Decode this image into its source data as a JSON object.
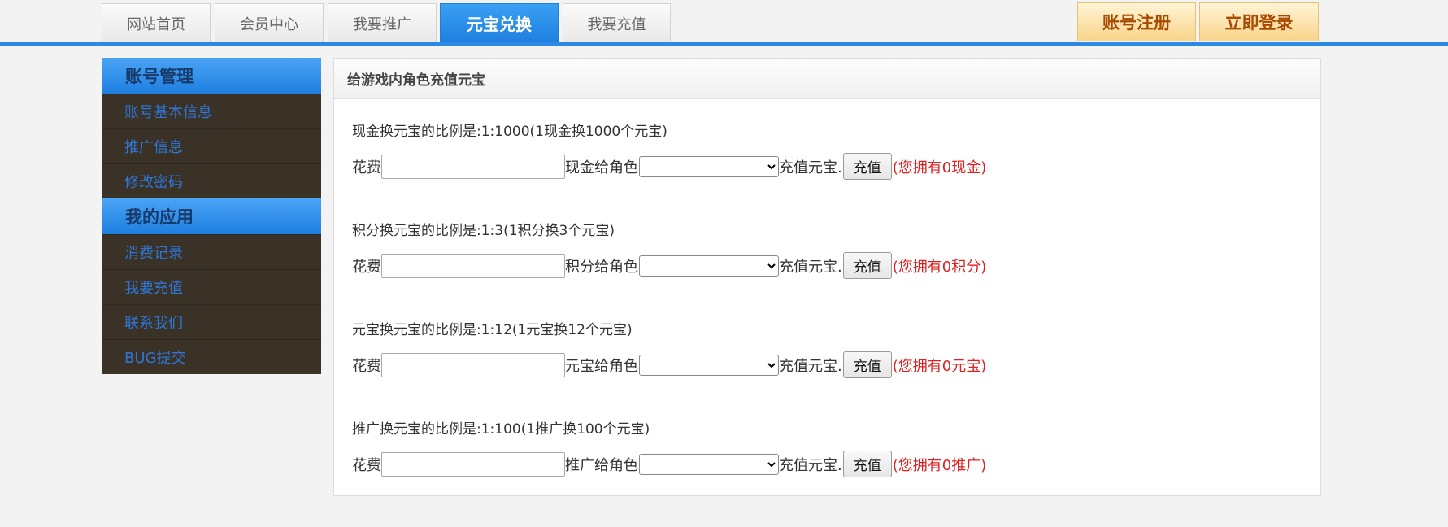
{
  "nav": {
    "tabs": [
      {
        "label": "网站首页"
      },
      {
        "label": "会员中心"
      },
      {
        "label": "我要推广"
      },
      {
        "label": "元宝兑换",
        "active": true
      },
      {
        "label": "我要充值"
      }
    ],
    "register": "账号注册",
    "login": "立即登录"
  },
  "sidebar": {
    "section1": "账号管理",
    "items1": [
      "账号基本信息",
      "推广信息",
      "修改密码"
    ],
    "section2": "我的应用",
    "items2": [
      "消费记录",
      "我要充值",
      "联系我们",
      "BUG提交"
    ]
  },
  "panel": {
    "title": "给游戏内角色充值元宝",
    "spend_label": "花费",
    "suffix": "充值元宝.",
    "button": "充值",
    "exchanges": [
      {
        "ratio": "现金换元宝的比例是:1:1000(1现金换1000个元宝)",
        "mid": "现金给角色",
        "owned": "(您拥有0现金)"
      },
      {
        "ratio": "积分换元宝的比例是:1:3(1积分换3个元宝)",
        "mid": "积分给角色",
        "owned": "(您拥有0积分)"
      },
      {
        "ratio": "元宝换元宝的比例是:1:12(1元宝换12个元宝)",
        "mid": "元宝给角色",
        "owned": "(您拥有0元宝)"
      },
      {
        "ratio": "推广换元宝的比例是:1:100(1推广换100个元宝)",
        "mid": "推广给角色",
        "owned": "(您拥有0推广)"
      }
    ]
  },
  "colors": {
    "accent": "#2c8ae6",
    "sidebar_bg": "#3a3226",
    "owned": "#e02020"
  }
}
